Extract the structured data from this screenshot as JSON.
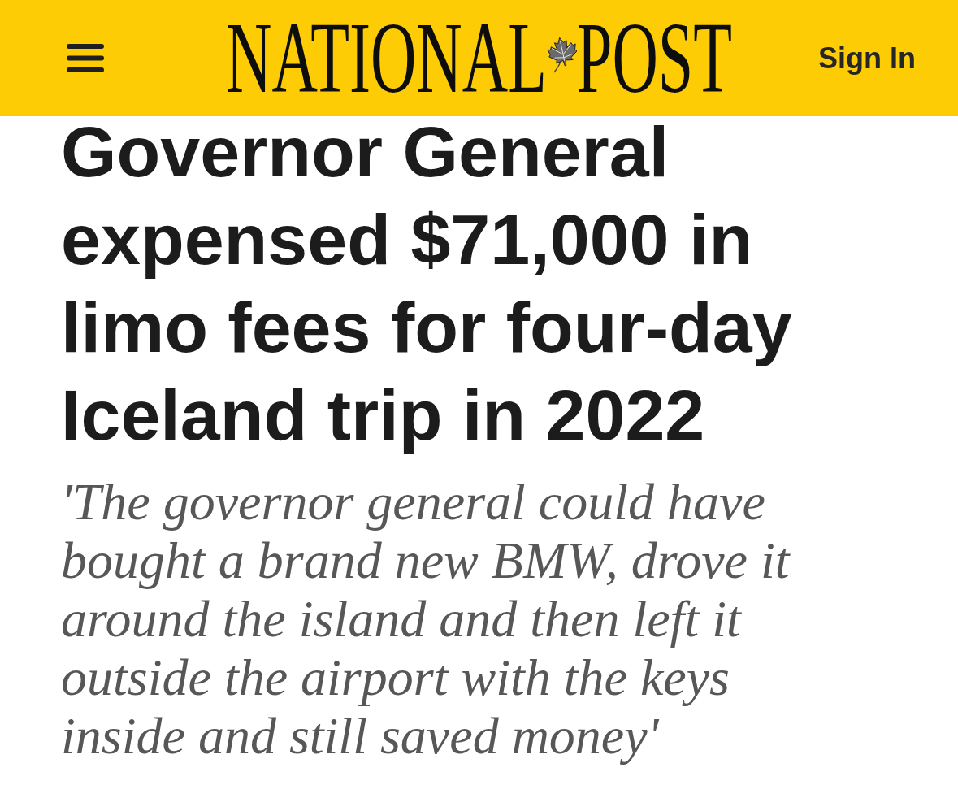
{
  "header": {
    "logo": {
      "words": [
        "NATIONAL",
        "POST"
      ]
    },
    "sign_in": "Sign In"
  },
  "article": {
    "headline": "Governor General expensed $71,000 in limo fees for four-day Iceland trip in 2022",
    "subheadline": "'The governor general could have bought a brand new BMW, drove it around the island and then left it outside the airport with the keys inside and still saved money'"
  }
}
